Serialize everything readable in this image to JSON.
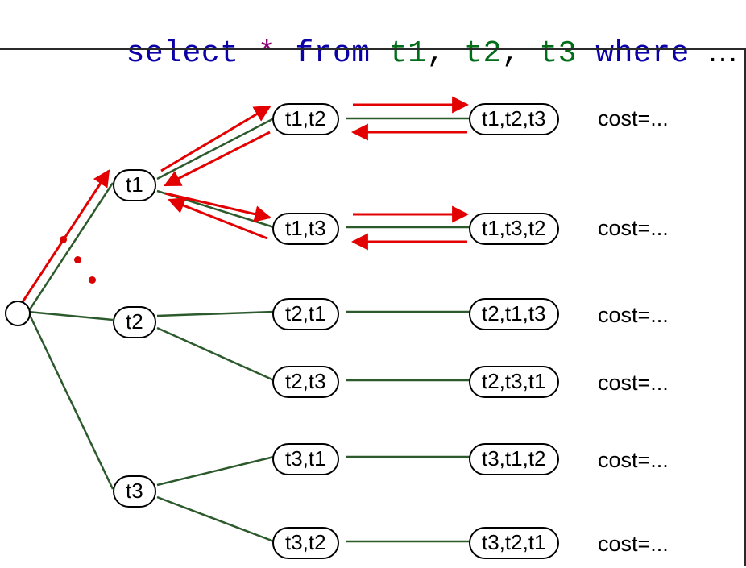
{
  "sql": {
    "select": "select",
    "star": "*",
    "from": "from",
    "t1": "t1",
    "t2": "t2",
    "t3": "t3",
    "where": "where",
    "comma": ",",
    "ellipsis": "..."
  },
  "nodes": {
    "root": "",
    "l1": {
      "t1": "t1",
      "t2": "t2",
      "t3": "t3"
    },
    "l2": {
      "t1t2": "t1,t2",
      "t1t3": "t1,t3",
      "t2t1": "t2,t1",
      "t2t3": "t2,t3",
      "t3t1": "t3,t1",
      "t3t2": "t3,t2"
    },
    "l3": {
      "t1t2t3": "t1,t2,t3",
      "t1t3t2": "t1,t3,t2",
      "t2t1t3": "t2,t1,t3",
      "t2t3t1": "t2,t3,t1",
      "t3t1t2": "t3,t1,t2",
      "t3t2t1": "t3,t2,t1"
    }
  },
  "cost_label": "cost=...",
  "colors": {
    "edge": "#2c5a2c",
    "highlight": "#e30000",
    "node_stroke": "#000000"
  }
}
